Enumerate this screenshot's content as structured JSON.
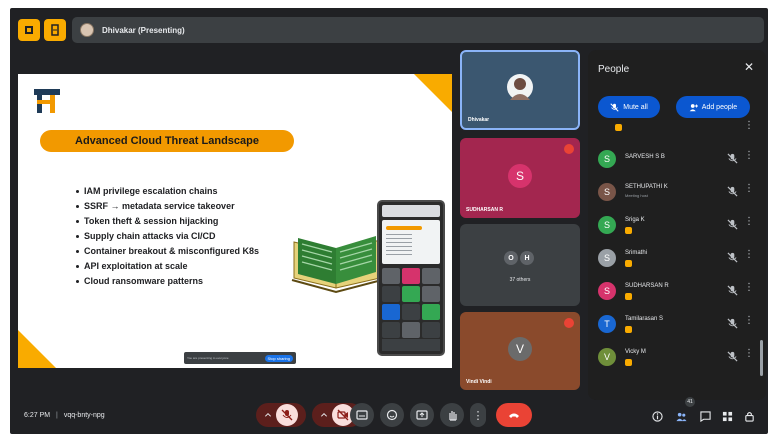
{
  "topbar": {
    "presenter_label": "Dhivakar (Presenting)",
    "icons": [
      "presentation-icon",
      "document-icon"
    ]
  },
  "slide": {
    "title": "Advanced Cloud Threat Landscape",
    "bullets": [
      "IAM privilege escalation chains",
      "SSRF → metadata service takeover",
      "Token theft & session hijacking",
      "Supply chain attacks via CI/CD",
      "Container breakout & misconfigured K8s",
      "API exploitation at scale",
      "Cloud ransomware patterns"
    ],
    "share_notice": "You are presenting to everyone",
    "share_button": "Stop sharing"
  },
  "tiles": [
    {
      "name": "Dhivakar",
      "bg": "#3b5770"
    },
    {
      "name": "SUDHARSAN R",
      "initial": "S",
      "bg": "#a3264f",
      "avatar": "#d6336c"
    },
    {
      "initials": [
        "O",
        "H"
      ],
      "others": "37 others",
      "bg": "#3c4043"
    },
    {
      "name": "Vindi Vindi",
      "initial": "V",
      "bg": "#8a4a2c",
      "avatar": "#6b6b6b"
    }
  ],
  "people": {
    "title": "People",
    "mute_all": "Mute all",
    "add_people": "Add people",
    "members": [
      {
        "name": "SARVESH S B",
        "initial": "S",
        "color": "#34a853"
      },
      {
        "name": "SETHUPATHI K",
        "subtitle": "Meeting host",
        "initial": "S",
        "color": "#795548"
      },
      {
        "name": "Sriga K",
        "initial": "S",
        "color": "#34a853",
        "badge": true
      },
      {
        "name": "Srimathi",
        "initial": "S",
        "color": "#9aa0a6",
        "badge": true
      },
      {
        "name": "SUDHARSAN R",
        "initial": "S",
        "color": "#d6336c",
        "badge": true
      },
      {
        "name": "Tamilarasan S",
        "initial": "T",
        "color": "#1967d2",
        "badge": true
      },
      {
        "name": "Vicky M",
        "initial": "V",
        "color": "#6f8f3a",
        "badge": true
      }
    ]
  },
  "bottombar": {
    "time": "6:27 PM",
    "separator": "|",
    "meeting_code": "vqq-bnty-npg",
    "participant_count": "41",
    "leave_color": "#ea4335"
  }
}
